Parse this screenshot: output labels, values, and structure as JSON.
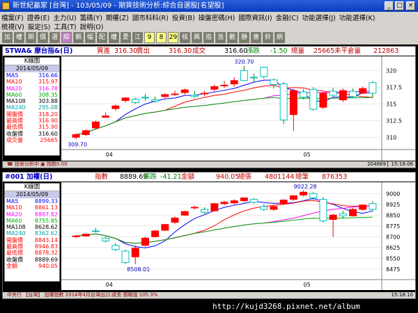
{
  "window": {
    "title": "新世紀贏家 [台灣] - 103/05/09 - 期貨技術分析:綜合自選股[名望股]"
  },
  "menu": {
    "row1": [
      "檔案(F)",
      "證券(E)",
      "主力(U)",
      "籌碼(Y)",
      "期權(Z)",
      "國市科科(R)",
      "投資(B)",
      "操盤密碼(H)",
      "國際資訊(I)",
      "金融(C)",
      "功能選擇(J)",
      "功能選擇(K)"
    ],
    "row2": [
      "梳視(V)",
      "設定(S)",
      "工具(T)",
      "說明(O)"
    ]
  },
  "toolbar": {
    "buttons": [
      "加",
      "權",
      "期",
      "價",
      "選",
      "綜",
      "類",
      "幅",
      "配",
      "權",
      "愛",
      "江",
      "9",
      "8",
      "29",
      "核",
      "興",
      "指",
      "浩",
      "觀",
      "靜",
      "惠",
      "鈴",
      "網"
    ]
  },
  "panel1": {
    "header": {
      "code": "STWA& 摩台指&(日)",
      "buy_label": "買進",
      "buy": "316.30",
      "sell_label": "賣出",
      "sell": "316.30",
      "trade_label": "成交",
      "trade": "316.60",
      "chg_label": "漲跌",
      "chg": "-1.50",
      "vol_label": "總量",
      "vol": "25665",
      "oi_label": "未平倉量",
      "oi": "212863"
    },
    "side_title": "K線圖",
    "date": "2014/05/09",
    "rows": [
      {
        "k": "MA5",
        "v": "316.66",
        "c": "#0000ff"
      },
      {
        "k": "MA10",
        "v": "315.97",
        "c": "#ff0000"
      },
      {
        "k": "MA20",
        "v": "316.78",
        "c": "#ff00ff"
      },
      {
        "k": "MA60",
        "v": "308.35",
        "c": "#00aa00"
      },
      {
        "k": "MA108",
        "v": "303.88",
        "c": "#000000"
      },
      {
        "k": "MA240",
        "v": "295.08",
        "c": "#00a0a0"
      },
      {
        "k": "開盤價",
        "v": "318.20",
        "c": "#ff0000"
      },
      {
        "k": "最高價",
        "v": "316.90",
        "c": "#ff0000"
      },
      {
        "k": "最低價",
        "v": "315.90",
        "c": "#ff0000"
      },
      {
        "k": "收盤價",
        "v": "316.60",
        "c": "#000000"
      },
      {
        "k": "成交量",
        "v": "25665",
        "c": "#ff0000"
      }
    ],
    "status": "☎ 技術分析中 ▣ 指数0.00",
    "status_right": "204669 ▏15:18:06"
  },
  "panel2": {
    "header": {
      "code": "#001 加權(日)",
      "idx_label": "指數",
      "idx": "8889.69",
      "chg_label": "漲跌",
      "chg": "-41.21",
      "amt_label": "金額",
      "amt": "940.05",
      "vol_label": "總張",
      "vol": "4801144",
      "cnt_label": "總筆",
      "cnt": "876353"
    },
    "side_title": "K線圖",
    "date": "2014/05/09",
    "rows": [
      {
        "k": "MA5",
        "v": "8899.33",
        "c": "#0000ff"
      },
      {
        "k": "MA10",
        "v": "8861.13",
        "c": "#ff0000"
      },
      {
        "k": "MA20",
        "v": "8897.82",
        "c": "#ff00ff"
      },
      {
        "k": "MA60",
        "v": "8755.85",
        "c": "#00aa00"
      },
      {
        "k": "MA108",
        "v": "8628.62",
        "c": "#000000"
      },
      {
        "k": "MA240",
        "v": "8362.62",
        "c": "#00a0a0"
      },
      {
        "k": "開盤價",
        "v": "8843.14",
        "c": "#ff0000"
      },
      {
        "k": "最高價",
        "v": "8946.83",
        "c": "#ff0000"
      },
      {
        "k": "最低價",
        "v": "8878.32",
        "c": "#ff0000"
      },
      {
        "k": "收盤價",
        "v": "8889.69",
        "c": "#000000"
      },
      {
        "k": "金額",
        "v": "940.05",
        "c": "#ff0000"
      }
    ],
    "status": "中央行 【台灣】 加權指數 2014年4月台灣出口:成長 預期值 105.3%",
    "status_right": "15:18:10"
  },
  "footer": {
    "url": "http://kujd3268.pixnet.net/album"
  },
  "chart_data": [
    {
      "type": "candlestick",
      "name": "摩台指",
      "x_labels": [
        "04",
        "05"
      ],
      "y_ticks": [
        310.0,
        312.5,
        315.0,
        317.5,
        320.0
      ],
      "ylim": [
        309.0,
        321.5
      ],
      "annotations": [
        "320.70",
        "309.70"
      ],
      "ohlc": [
        [
          310.0,
          310.6,
          309.7,
          310.4
        ],
        [
          310.4,
          311.2,
          310.2,
          311.0
        ],
        [
          311.4,
          312.5,
          311.2,
          312.3
        ],
        [
          313.0,
          313.7,
          312.9,
          313.2
        ],
        [
          314.3,
          314.9,
          314.0,
          314.7
        ],
        [
          315.5,
          316.0,
          315.2,
          315.9
        ],
        [
          315.7,
          315.9,
          315.0,
          315.2
        ],
        [
          316.0,
          316.5,
          315.5,
          315.9
        ],
        [
          315.6,
          316.1,
          315.2,
          315.4
        ],
        [
          316.1,
          316.6,
          315.9,
          316.4
        ],
        [
          316.5,
          317.0,
          316.2,
          316.5
        ],
        [
          316.7,
          317.3,
          316.4,
          317.1
        ],
        [
          316.3,
          316.9,
          315.9,
          316.1
        ],
        [
          316.6,
          317.0,
          316.2,
          316.6
        ],
        [
          317.2,
          317.9,
          316.9,
          317.6
        ],
        [
          317.8,
          318.4,
          317.4,
          317.8
        ],
        [
          318.0,
          319.0,
          317.6,
          318.5
        ],
        [
          320.0,
          320.7,
          318.4,
          318.5
        ],
        [
          319.0,
          319.5,
          318.2,
          318.9
        ],
        [
          320.5,
          320.6,
          318.8,
          319.1
        ],
        [
          318.6,
          318.8,
          317.3,
          317.9
        ],
        [
          318.0,
          318.3,
          312.0,
          312.6
        ],
        [
          313.4,
          317.1,
          311.0,
          317.0
        ],
        [
          316.8,
          317.2,
          315.7,
          316.0
        ],
        [
          317.2,
          317.5,
          314.0,
          314.2
        ],
        [
          314.5,
          316.8,
          314.2,
          316.6
        ],
        [
          316.9,
          317.4,
          316.1,
          316.3
        ],
        [
          315.6,
          317.3,
          315.3,
          317.0
        ],
        [
          316.9,
          317.3,
          316.0,
          316.1
        ],
        [
          316.6,
          317.6,
          316.5,
          317.3
        ],
        [
          318.2,
          318.4,
          315.9,
          316.6
        ]
      ]
    },
    {
      "type": "candlestick",
      "name": "加權",
      "x_labels": [
        "04",
        "05"
      ],
      "y_ticks": [
        8475,
        8550,
        8625,
        8700,
        8775,
        8850,
        8925,
        9000
      ],
      "ylim": [
        8440,
        9050
      ],
      "annotations": [
        "9022.28",
        "8508.01"
      ],
      "ohlc": [
        [
          8700,
          8712,
          8690,
          8705
        ],
        [
          8705,
          8722,
          8700,
          8718
        ],
        [
          8740,
          8760,
          8730,
          8735
        ],
        [
          8690,
          8700,
          8660,
          8670
        ],
        [
          8640,
          8655,
          8600,
          8610
        ],
        [
          8600,
          8610,
          8510,
          8520
        ],
        [
          8560,
          8640,
          8508,
          8620
        ],
        [
          8640,
          8700,
          8630,
          8690
        ],
        [
          8700,
          8745,
          8695,
          8740
        ],
        [
          8745,
          8790,
          8740,
          8785
        ],
        [
          8800,
          8840,
          8790,
          8830
        ],
        [
          8850,
          8880,
          8845,
          8875
        ],
        [
          8900,
          8915,
          8890,
          8905
        ],
        [
          8890,
          8905,
          8860,
          8870
        ],
        [
          8880,
          8935,
          8875,
          8930
        ],
        [
          8930,
          8950,
          8920,
          8940
        ],
        [
          8935,
          8960,
          8925,
          8950
        ],
        [
          8950,
          8975,
          8940,
          8970
        ],
        [
          8960,
          8970,
          8930,
          8940
        ],
        [
          8910,
          8925,
          8880,
          8890
        ],
        [
          8890,
          8915,
          8880,
          8910
        ],
        [
          8930,
          8960,
          8920,
          8955
        ],
        [
          8960,
          8990,
          8950,
          8985
        ],
        [
          8990,
          9022,
          8980,
          9010
        ],
        [
          9000,
          9010,
          8960,
          8970
        ],
        [
          8960,
          8975,
          8800,
          8810
        ],
        [
          8820,
          8860,
          8700,
          8850
        ],
        [
          8860,
          8880,
          8830,
          8845
        ],
        [
          8845,
          8900,
          8840,
          8890
        ],
        [
          8890,
          8925,
          8880,
          8920
        ],
        [
          8930,
          8946,
          8878,
          8890
        ]
      ]
    }
  ]
}
